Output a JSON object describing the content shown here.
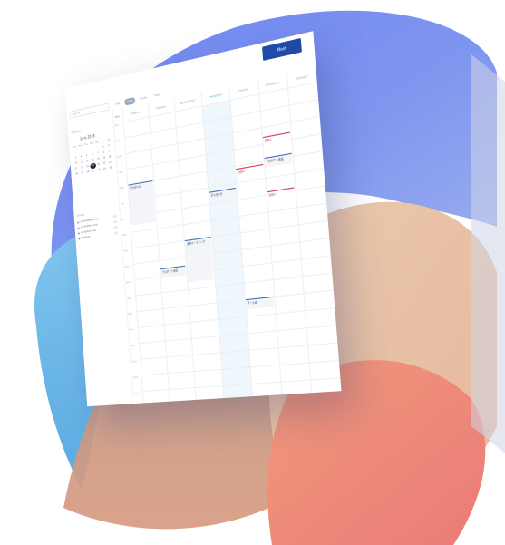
{
  "header": {
    "search_placeholder": "Search",
    "view_tabs": [
      "Day",
      "Week",
      "Month",
      "Today"
    ],
    "meet_label": "Meet"
  },
  "sidebar": {
    "calendar_label": "Calendar",
    "month_title": "June 2018",
    "weekday_headers": [
      "Sun",
      "Mon",
      "Tue",
      "Wed",
      "Thu",
      "Fri",
      "Sat"
    ],
    "weeks": [
      [
        "",
        "",
        "",
        "",
        "",
        "1",
        "2"
      ],
      [
        "3",
        "4",
        "5",
        "6",
        "7",
        "8",
        "9"
      ],
      [
        "10",
        "11",
        "12",
        "13",
        "14",
        "15",
        "16"
      ],
      [
        "17",
        "18",
        "19",
        "20",
        "21",
        "22",
        "23"
      ],
      [
        "24",
        "25",
        "26",
        "27",
        "28",
        "29",
        "30"
      ]
    ],
    "today": "20",
    "groups_label": "Groups",
    "groups": [
      "yamada@tech.co.jp",
      "suzuki@tech.co.jp",
      "sato@tech.co.jp",
      "Meetings"
    ]
  },
  "calendar": {
    "day_column_label": "DAY",
    "days": [
      "MONDAY",
      "TUESDAY",
      "WEDNESDAY",
      "THURSDAY",
      "FRIDAY",
      "SATURDAY",
      "SUNDAY"
    ],
    "hours": [
      "8am",
      "9am",
      "10am",
      "11am",
      "12pm",
      "1pm",
      "2pm",
      "3pm",
      "4pm",
      "5pm",
      "6pm",
      "7pm",
      "8pm",
      "9pm",
      "10pm",
      "11pm",
      "12am",
      "1am"
    ],
    "events": [
      {
        "day": 0,
        "start": 4.0,
        "label": "打ち合わせ",
        "color": "blue",
        "tall": true
      },
      {
        "day": 1,
        "start": 9.5,
        "label": "プロダクト会議",
        "color": "blue",
        "tall": false
      },
      {
        "day": 2,
        "start": 8.0,
        "label": "定例ミーティング",
        "color": "blue",
        "tall": true
      },
      {
        "day": 3,
        "start": 5.3,
        "label": "打ち合わせ",
        "color": "blue",
        "tall": false
      },
      {
        "day": 4,
        "start": 4.2,
        "label": "新規①",
        "color": "red",
        "tall": false
      },
      {
        "day": 4,
        "start": 12.0,
        "label": "チーム会",
        "color": "blue",
        "tall": false
      },
      {
        "day": 5,
        "start": 2.6,
        "label": "新規②",
        "color": "red",
        "tall": false
      },
      {
        "day": 5,
        "start": 3.8,
        "label": "プロダクト会議",
        "color": "blue",
        "tall": false
      },
      {
        "day": 5,
        "start": 5.8,
        "label": "新規③",
        "color": "red",
        "tall": false
      }
    ]
  },
  "colors": {
    "accent": "#1f4aa8",
    "today_column": "#45b3d6",
    "event_blue": "#3f6db8",
    "event_red": "#d23a52"
  }
}
